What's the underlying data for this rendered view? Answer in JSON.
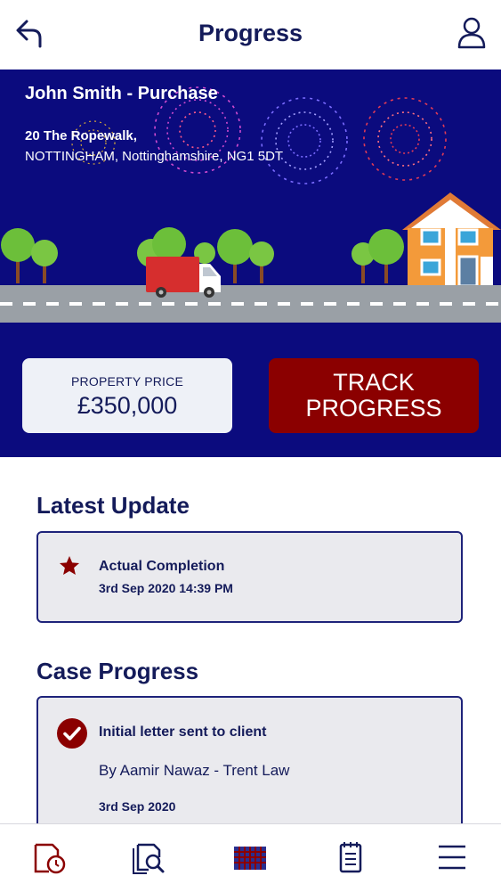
{
  "header": {
    "title": "Progress",
    "back_icon": "back-arrow-icon",
    "user_icon": "user-icon"
  },
  "hero": {
    "name": "John Smith - Purchase",
    "address_line1": "20 The Ropewalk,",
    "address_line2": "NOTTINGHAM, Nottinghamshire, NG1 5DT",
    "price_label": "PROPERTY PRICE",
    "price_value": "£350,000",
    "track_button_line1": "TRACK",
    "track_button_line2": "PROGRESS"
  },
  "latest_update": {
    "title": "Latest Update",
    "item_title": "Actual Completion",
    "item_date": "3rd Sep 2020 14:39 PM",
    "icon": "star-icon"
  },
  "case_progress": {
    "title": "Case Progress",
    "item_title": "Initial letter sent to client",
    "item_by": "By Aamir Nawaz - Trent Law",
    "item_date": "3rd Sep 2020",
    "icon": "check-circle-icon"
  },
  "bottom_nav": [
    {
      "icon": "clock-document-icon"
    },
    {
      "icon": "search-document-icon"
    },
    {
      "icon": "calendar-grid-icon"
    },
    {
      "icon": "notepad-icon"
    },
    {
      "icon": "menu-icon"
    }
  ],
  "colors": {
    "navy": "#0b0b7e",
    "dark_text": "#141b5a",
    "accent_red": "#8b0000"
  }
}
